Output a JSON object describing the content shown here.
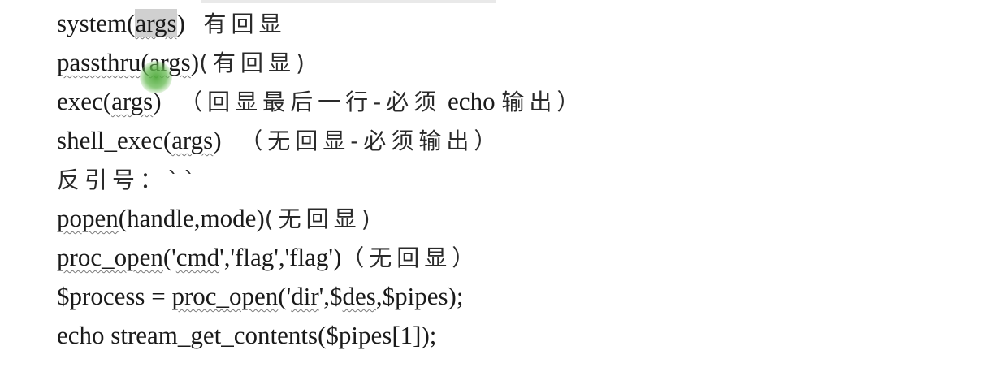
{
  "lines": [
    {
      "parts": [
        "system(",
        "args",
        ") ",
        " 有回显"
      ]
    },
    {
      "parts": [
        "passthru",
        "(",
        "args",
        ")",
        "(有回显)"
      ]
    },
    {
      "parts": [
        "exec(",
        "args",
        ") ",
        " （回显最后一行-必须",
        " echo ",
        "输出）"
      ]
    },
    {
      "parts": [
        "shell_exec(",
        "args",
        ") ",
        " （无回显-必须输出）"
      ]
    },
    {
      "parts": [
        "反引号：``"
      ]
    },
    {
      "parts": [
        "popen",
        "(handle,mode)",
        "(无回显)"
      ]
    },
    {
      "parts": [
        "proc_open",
        "('",
        "cmd",
        "','flag','flag')",
        "（无回显）"
      ]
    },
    {
      "parts": [
        "$process = ",
        "proc_open",
        "('",
        "dir",
        "',$",
        "des",
        ",$pipes);"
      ]
    },
    {
      "parts": [
        "echo stream_get_contents($pipes[1]);"
      ]
    }
  ]
}
